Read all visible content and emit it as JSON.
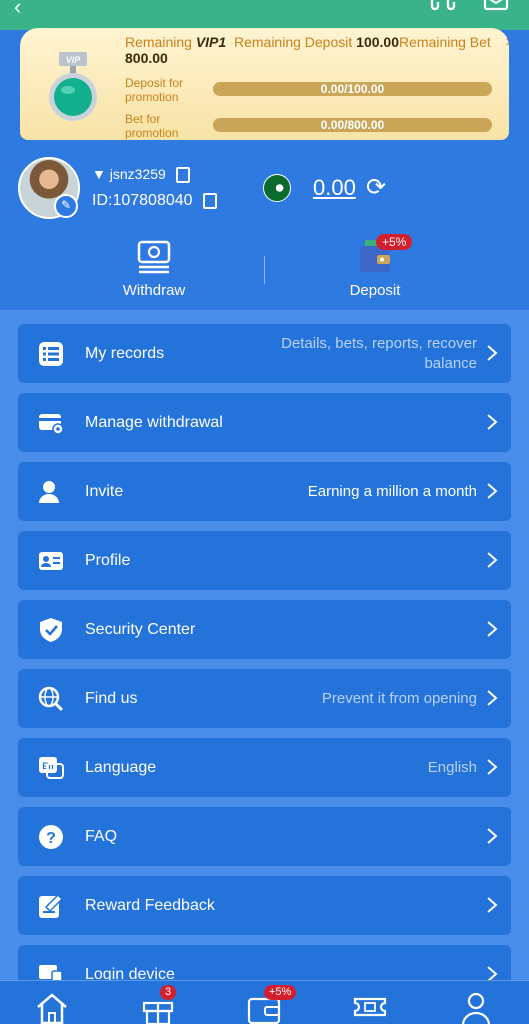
{
  "vip": {
    "remaining_label": "Remaining",
    "level": "VIP1",
    "deposit_label": "Remaining Deposit",
    "deposit_value": "100.00",
    "bet_label": "Remaining Bet",
    "bet_value": "800.00",
    "badge_text": "VIP",
    "deposit_promo_label": "Deposit for promotion",
    "deposit_progress": "0.00/100.00",
    "deposit_fraction": 0,
    "bet_promo_label": "Bet for promotion",
    "bet_progress": "0.00/800.00",
    "bet_fraction": 0
  },
  "user": {
    "username": "jsnz3259",
    "id": "ID:107808040",
    "balance": "0.00"
  },
  "actions": {
    "withdraw": "Withdraw",
    "deposit": "Deposit",
    "deposit_badge": "+5%"
  },
  "menu": [
    {
      "label": "My records",
      "hint": "Details, bets, reports, recover balance",
      "icon": "records-icon"
    },
    {
      "label": "Manage withdrawal",
      "hint": "",
      "icon": "card-icon"
    },
    {
      "label": "Invite",
      "hint": "Earning a million a month",
      "icon": "invite-icon"
    },
    {
      "label": "Profile",
      "hint": "",
      "icon": "profile-card-icon"
    },
    {
      "label": "Security Center",
      "hint": "",
      "icon": "shield-icon"
    },
    {
      "label": "Find us",
      "hint": "Prevent it from opening",
      "icon": "globe-search-icon"
    },
    {
      "label": "Language",
      "hint": "English",
      "icon": "language-icon"
    },
    {
      "label": "FAQ",
      "hint": "",
      "icon": "question-icon"
    },
    {
      "label": "Reward Feedback",
      "hint": "",
      "icon": "feedback-icon"
    },
    {
      "label": "Login device",
      "hint": "",
      "icon": "device-icon"
    }
  ],
  "bottom_nav": {
    "gift_badge": "3",
    "wallet_badge": "+5%"
  },
  "colors": {
    "primary": "#2f7ae0",
    "item_bg": "#2373db",
    "badge": "#d31f2b",
    "gold": "#c9821b"
  }
}
